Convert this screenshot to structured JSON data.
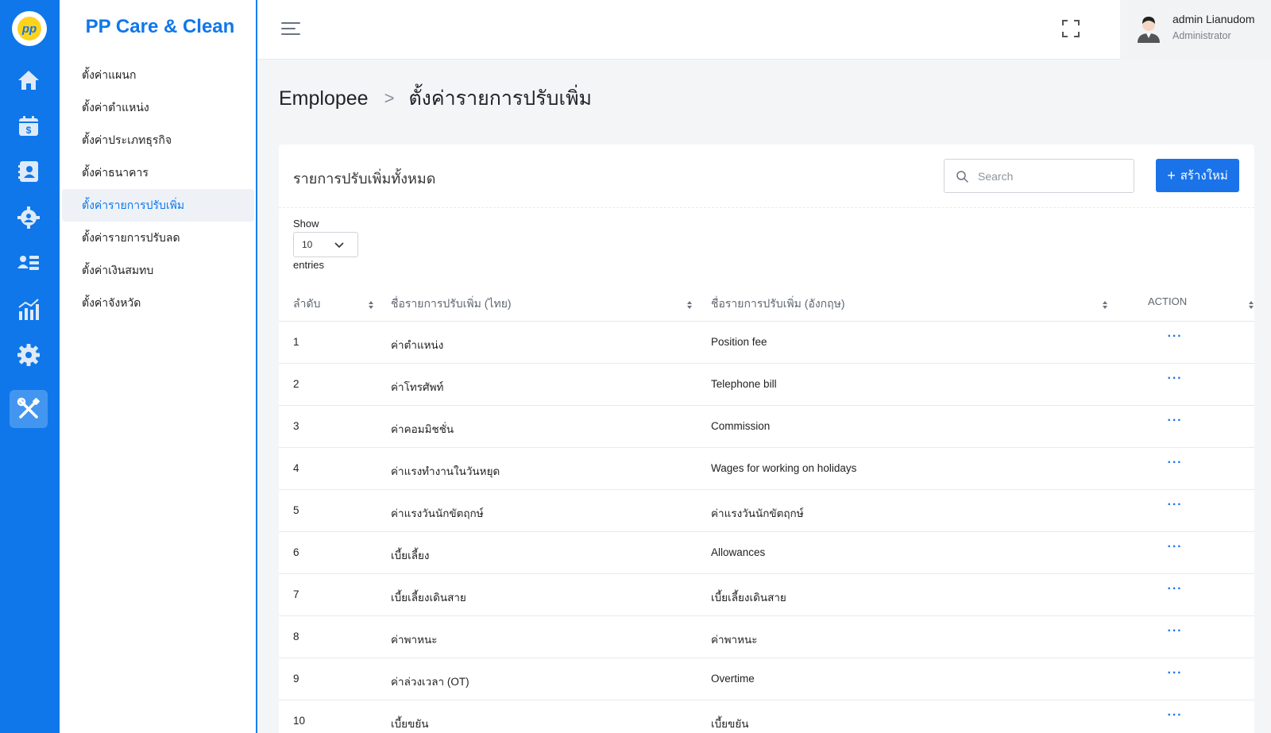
{
  "app": {
    "brand": "PP Care & Clean",
    "logo_text": "pp"
  },
  "rail": {
    "icons": [
      "home-icon",
      "calendar-dollar-icon",
      "contact-card-icon",
      "team-gear-icon",
      "user-list-icon",
      "analytics-chart-icon",
      "settings-gear-icon",
      "tools-icon"
    ],
    "active_index": 7
  },
  "submenu": {
    "items": [
      {
        "label": "ตั้งค่าแผนก",
        "active": false
      },
      {
        "label": "ตั้งค่าตำแหน่ง",
        "active": false
      },
      {
        "label": "ตั้งค่าประเภทธุรกิจ",
        "active": false
      },
      {
        "label": "ตั้งค่าธนาคาร",
        "active": false
      },
      {
        "label": "ตั้งค่ารายการปรับเพิ่ม",
        "active": true
      },
      {
        "label": "ตั้งค่ารายการปรับลด",
        "active": false
      },
      {
        "label": "ตั้งค่าเงินสมทบ",
        "active": false
      },
      {
        "label": "ตั้งค่าจังหวัด",
        "active": false
      }
    ]
  },
  "topbar": {
    "user_name": "admin Lianudom",
    "user_role": "Administrator"
  },
  "breadcrumb": {
    "parent": "Emplopee",
    "separator": ">",
    "current": "ตั้งค่ารายการปรับเพิ่ม"
  },
  "card": {
    "title": "รายการปรับเพิ่มทั้งหมด",
    "search_placeholder": "Search",
    "create_label": "สร้างใหม่",
    "create_plus": "+",
    "show_label": "Show",
    "page_length": "10",
    "entries_label": "entries"
  },
  "table": {
    "headers": [
      "ลำดับ",
      "ชื่อรายการปรับเพิ่ม (ไทย)",
      "ชื่อรายการปรับเพิ่ม (อังกฤษ)",
      "ACTION"
    ],
    "action_symbol": "···",
    "rows": [
      {
        "no": "1",
        "th": "ค่าตำแหน่ง",
        "en": "Position fee"
      },
      {
        "no": "2",
        "th": "ค่าโทรศัพท์",
        "en": "Telephone bill"
      },
      {
        "no": "3",
        "th": "ค่าคอมมิชชั่น",
        "en": "Commission"
      },
      {
        "no": "4",
        "th": "ค่าแรงทำงานในวันหยุด",
        "en": "Wages for working on holidays"
      },
      {
        "no": "5",
        "th": "ค่าแรงวันนักขัตฤกษ์",
        "en": "ค่าแรงวันนักขัตฤกษ์"
      },
      {
        "no": "6",
        "th": "เบี้ยเลี้ยง",
        "en": "Allowances"
      },
      {
        "no": "7",
        "th": "เบี้ยเลี้ยงเดินสาย",
        "en": "เบี้ยเลี้ยงเดินสาย"
      },
      {
        "no": "8",
        "th": "ค่าพาหนะ",
        "en": "ค่าพาหนะ"
      },
      {
        "no": "9",
        "th": "ค่าล่วงเวลา (OT)",
        "en": "Overtime"
      },
      {
        "no": "10",
        "th": "เบี้ยขยัน",
        "en": "เบี้ยขยัน"
      }
    ]
  },
  "colors": {
    "primary": "#0f77ea",
    "button": "#1a73e8",
    "active_menu_bg": "#eef2f7"
  }
}
